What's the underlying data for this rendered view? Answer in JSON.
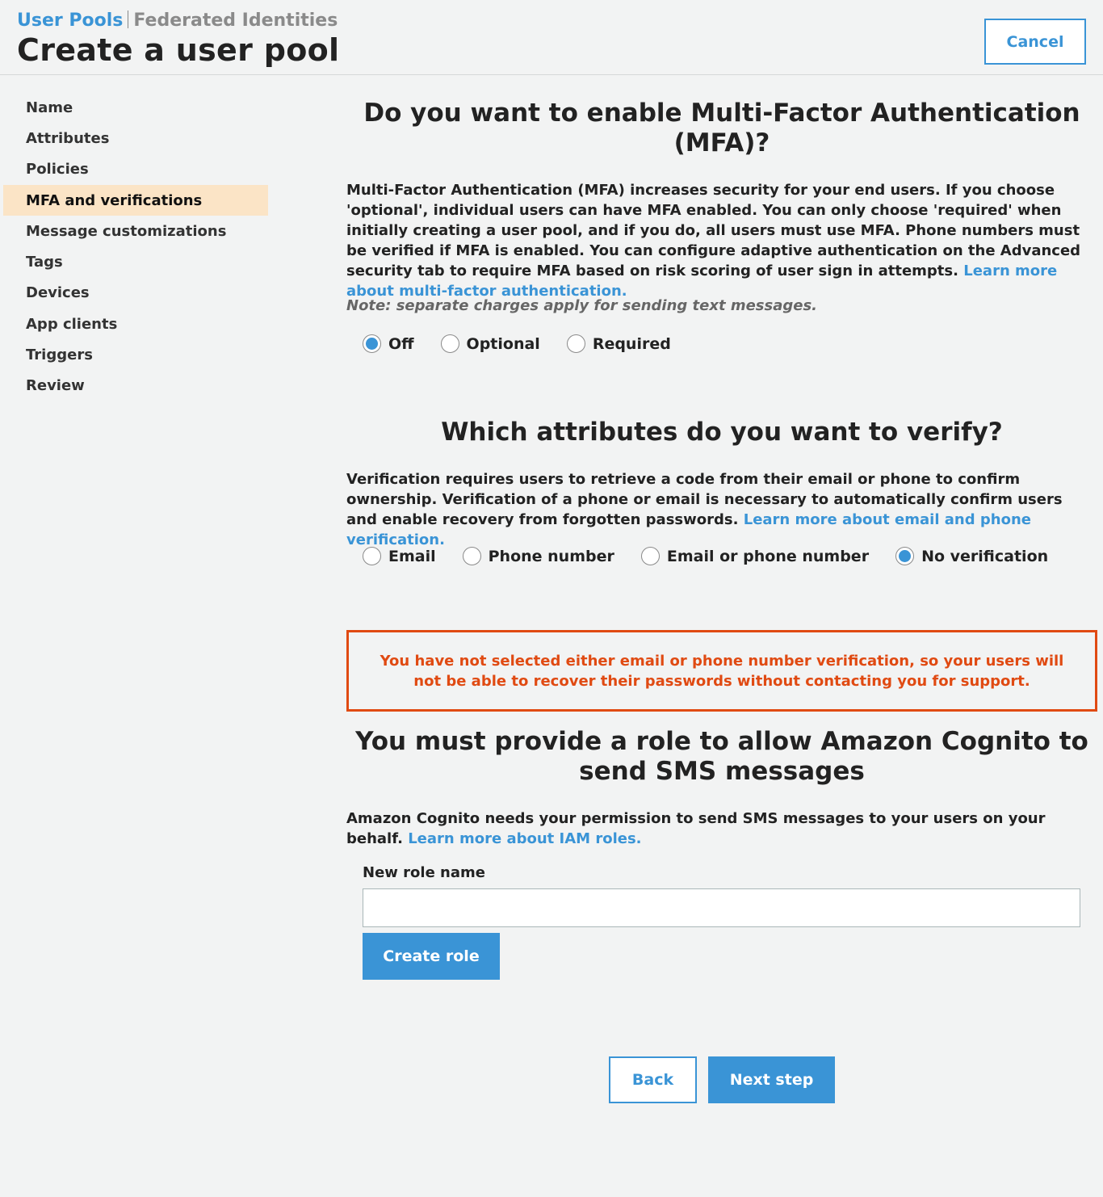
{
  "header": {
    "breadcrumb_active": "User Pools",
    "breadcrumb_inactive": "Federated Identities",
    "title": "Create a user pool",
    "cancel_label": "Cancel"
  },
  "sidebar": {
    "items": [
      {
        "label": "Name",
        "active": false
      },
      {
        "label": "Attributes",
        "active": false
      },
      {
        "label": "Policies",
        "active": false
      },
      {
        "label": "MFA and verifications",
        "active": true
      },
      {
        "label": "Message customizations",
        "active": false
      },
      {
        "label": "Tags",
        "active": false
      },
      {
        "label": "Devices",
        "active": false
      },
      {
        "label": "App clients",
        "active": false
      },
      {
        "label": "Triggers",
        "active": false
      },
      {
        "label": "Review",
        "active": false
      }
    ]
  },
  "mfa": {
    "title": "Do you want to enable Multi-Factor Authentication (MFA)?",
    "description": "Multi-Factor Authentication (MFA) increases security for your end users. If you choose 'optional', individual users can have MFA enabled. You can only choose 'required' when initially creating a user pool, and if you do, all users must use MFA. Phone numbers must be verified if MFA is enabled. You can configure adaptive authentication on the Advanced security tab to require MFA based on risk scoring of user sign in attempts.",
    "link": "Learn more about multi-factor authentication.",
    "note": "Note: separate charges apply for sending text messages.",
    "options": [
      "Off",
      "Optional",
      "Required"
    ],
    "selected": "Off"
  },
  "verify": {
    "title": "Which attributes do you want to verify?",
    "description": "Verification requires users to retrieve a code from their email or phone to confirm ownership. Verification of a phone or email is necessary to automatically confirm users and enable recovery from forgotten passwords.",
    "link": "Learn more about email and phone verification.",
    "options": [
      "Email",
      "Phone number",
      "Email or phone number",
      "No verification"
    ],
    "selected": "No verification"
  },
  "warning": {
    "text": "You have not selected either email or phone number verification, so your users will not be able to recover their passwords without contacting you for support."
  },
  "sms_role": {
    "title": "You must provide a role to allow Amazon Cognito to send SMS messages",
    "description": "Amazon Cognito needs your permission to send SMS messages to your users on your behalf.",
    "link": "Learn more about IAM roles.",
    "field_label": "New role name",
    "field_value": "",
    "create_label": "Create role"
  },
  "footer": {
    "back_label": "Back",
    "next_label": "Next step"
  },
  "colors": {
    "accent": "#3a94d6",
    "warning": "#e04a12",
    "active_nav_bg": "#fbe4c6",
    "page_bg": "#f2f3f3"
  }
}
